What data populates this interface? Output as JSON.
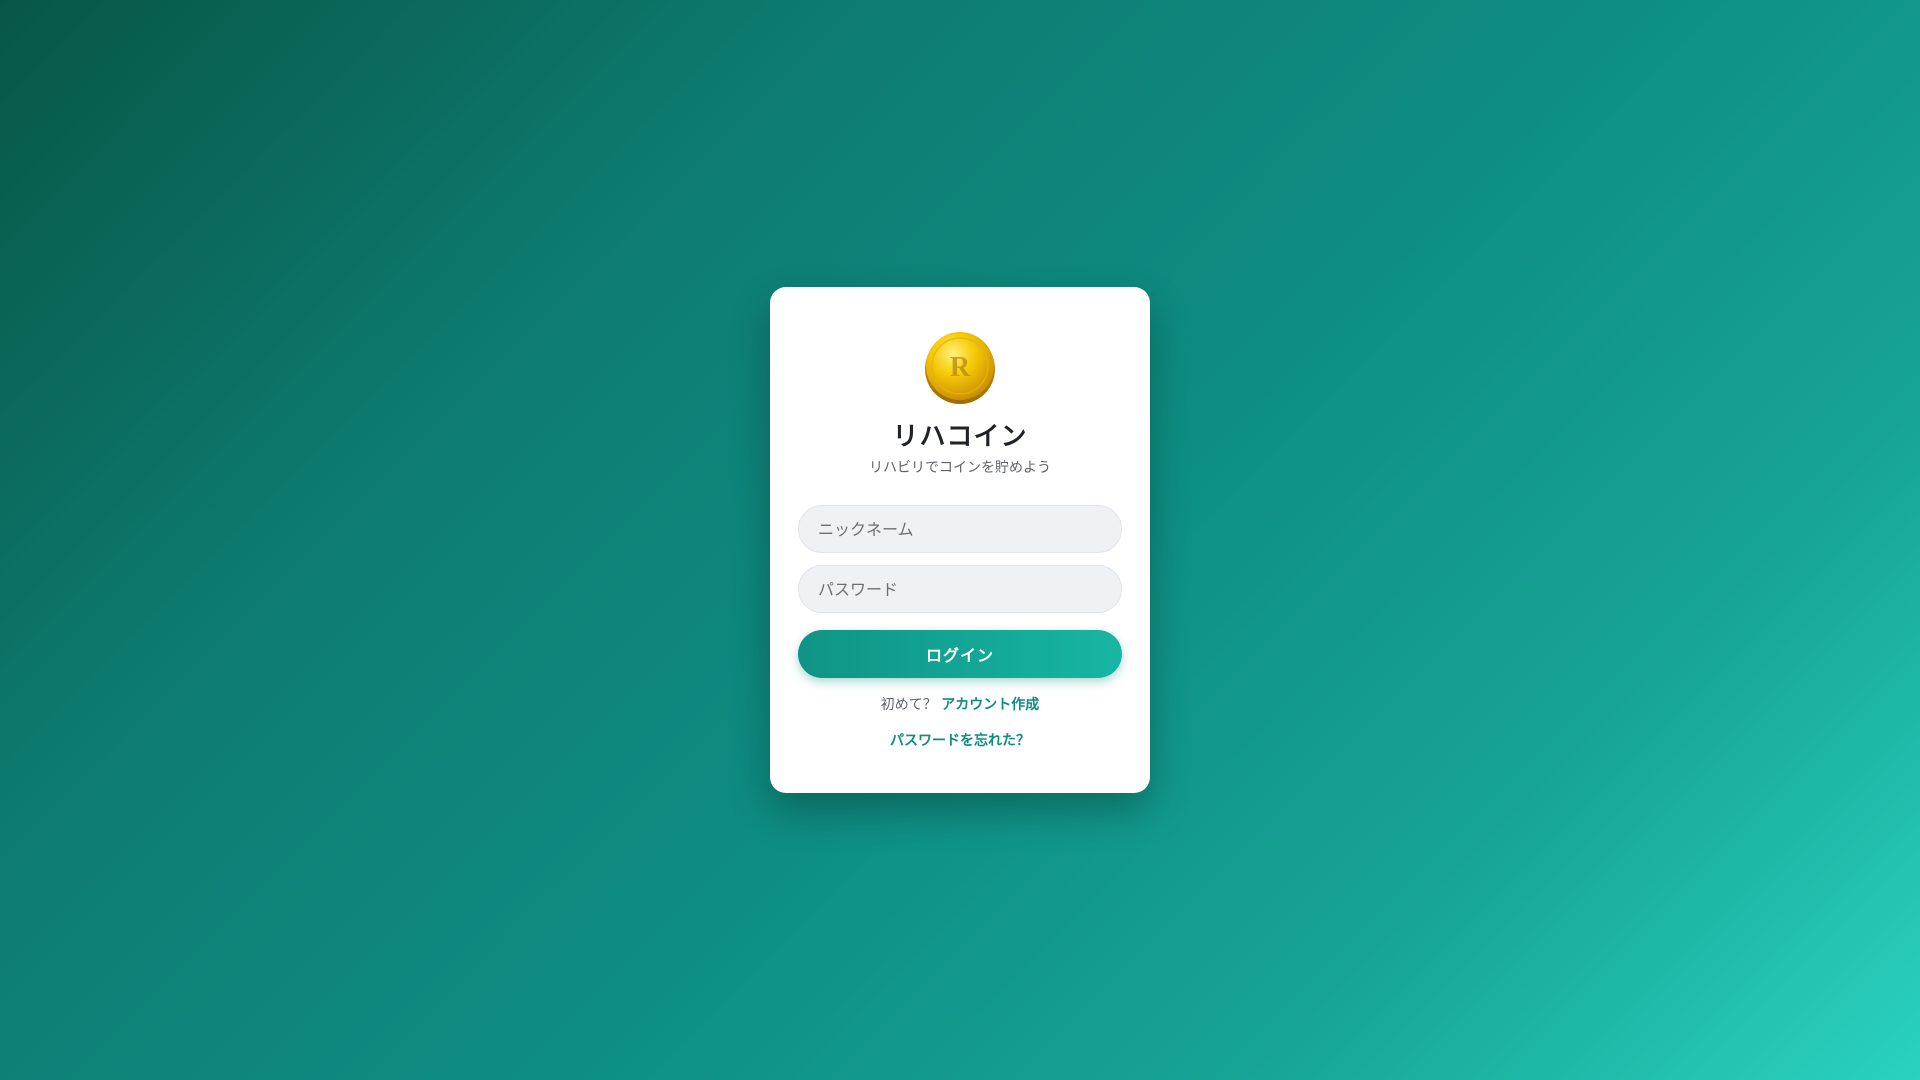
{
  "app": {
    "logo_letter": "R",
    "logo_icon": "gold-coin-icon",
    "title": "リハコイン",
    "subtitle": "リハビリでコインを貯めよう"
  },
  "form": {
    "nickname_placeholder": "ニックネーム",
    "nickname_value": "",
    "password_placeholder": "パスワード",
    "password_value": "",
    "login_label": "ログイン"
  },
  "footer": {
    "signup_prompt": "初めて？",
    "signup_link": "アカウント作成",
    "forgot_link": "パスワードを忘れた？"
  },
  "colors": {
    "accent": "#0e8c7e",
    "button_start": "#0f9485",
    "button_end": "#17b6a3",
    "coin_gold": "#f2c200"
  }
}
